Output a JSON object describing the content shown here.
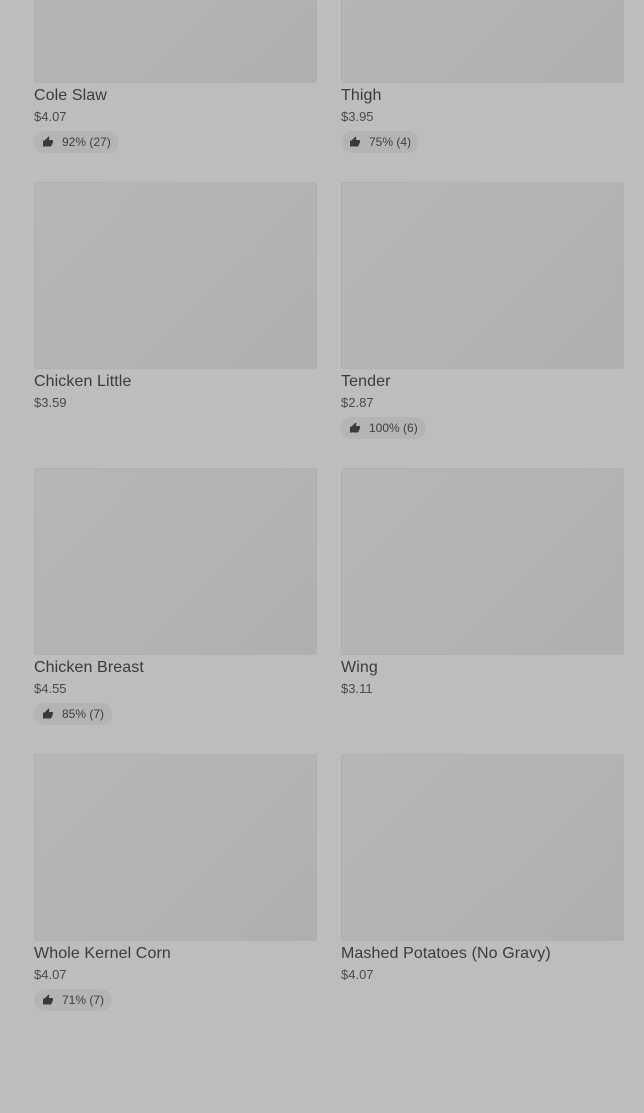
{
  "items": [
    {
      "name": "Cole Slaw",
      "price": "$4.07",
      "rating": "92% (27)",
      "thumb_icon": "thumbs-up-icon"
    },
    {
      "name": "Thigh",
      "price": "$3.95",
      "rating": "75% (4)",
      "thumb_icon": "thumbs-up-icon"
    },
    {
      "name": "Chicken Little",
      "price": "$3.59",
      "rating": null
    },
    {
      "name": "Tender",
      "price": "$2.87",
      "rating": "100% (6)",
      "thumb_icon": "thumbs-up-icon"
    },
    {
      "name": "Chicken Breast",
      "price": "$4.55",
      "rating": "85% (7)",
      "thumb_icon": "thumbs-up-icon"
    },
    {
      "name": "Wing",
      "price": "$3.11",
      "rating": null
    },
    {
      "name": "Whole Kernel Corn",
      "price": "$4.07",
      "rating": "71% (7)",
      "thumb_icon": "thumbs-up-icon"
    },
    {
      "name": "Mashed Potatoes (No Gravy)",
      "price": "$4.07",
      "rating": null
    }
  ],
  "colors": {
    "background": "#bdbdbd",
    "image_placeholder": "#b5b5b5",
    "rating_pill": "#b4b4b4",
    "text": "#3a3a3a"
  }
}
